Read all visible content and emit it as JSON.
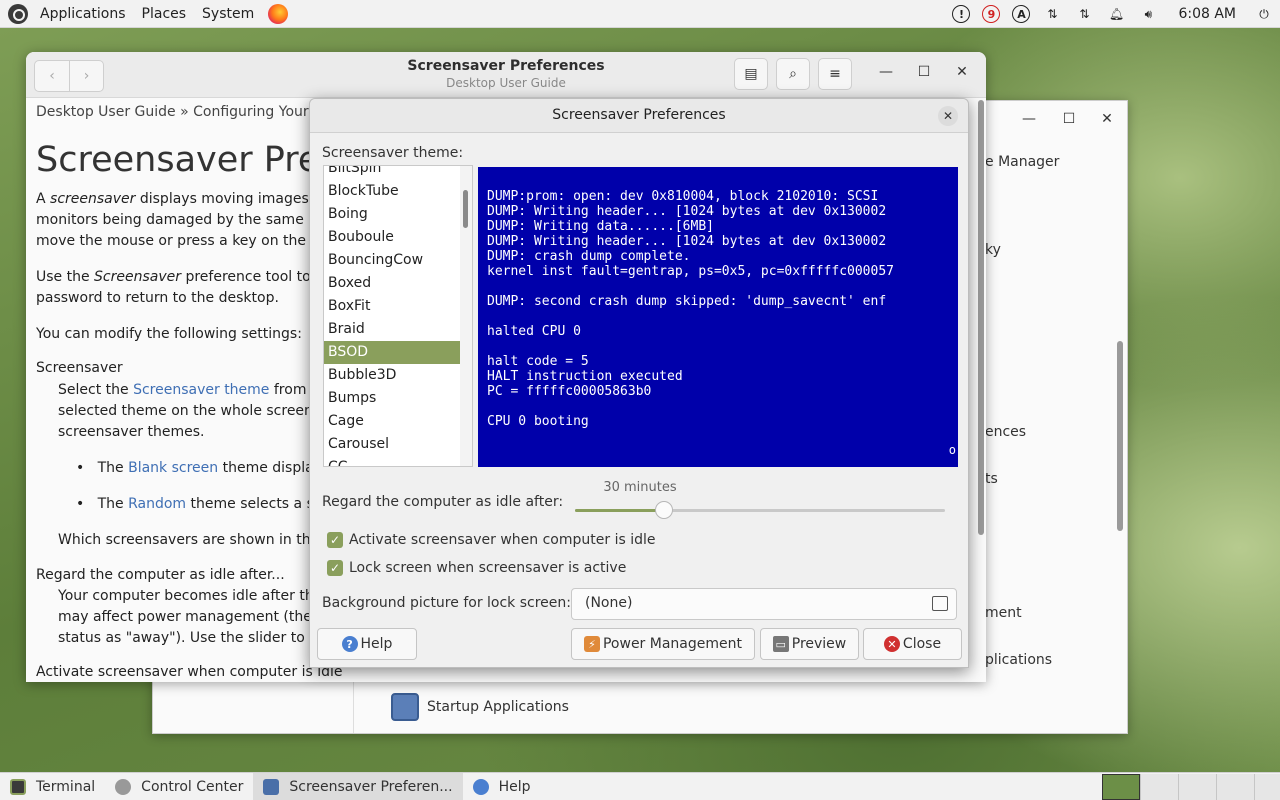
{
  "top_panel": {
    "menus": [
      "Applications",
      "Places",
      "System"
    ],
    "tray_badges": {
      "info": "!",
      "count": "9",
      "access": "A"
    },
    "clock": "6:08 AM"
  },
  "help_window": {
    "title": "Screensaver Preferences",
    "subtitle": "Desktop User Guide",
    "breadcrumb": "Desktop User Guide » Configuring Your D",
    "heading": "Screensaver Pref",
    "p1a_pre": "A ",
    "p1a_em": "screensaver",
    "p1a_post": " displays moving images or",
    "p1b": "monitors being damaged by the same im",
    "p1c": "move the mouse or press a key on the ke",
    "p2a_pre": "Use the ",
    "p2a_em": "Screensaver",
    "p2a_post": " preference tool to se",
    "p2b": "password to return to the desktop.",
    "p3": "You can modify the following settings:",
    "term1": "Screensaver",
    "t1a_pre": "Select the ",
    "t1a_link": "Screensaver theme",
    "t1a_post": " from th",
    "t1b": "selected theme on the whole screen.",
    "t1c": "screensaver themes.",
    "b1_pre": "The ",
    "b1_link": "Blank screen",
    "b1_post": " theme displays",
    "b2_pre": "The ",
    "b2_link": "Random",
    "b2_post": " theme selects a scr",
    "t1d": "Which screensavers are shown in the",
    "term2": "Regard the computer as idle after...",
    "t2a": "Your computer becomes idle after thi",
    "t2b": "may affect power management (the m",
    "t2c": "status as \"away\"). Use the slider to se",
    "term3": "Activate screensaver when computer is idle"
  },
  "control_center": {
    "items": [
      "e Manager",
      "ky",
      "ences",
      "ts",
      "ment",
      "plications"
    ],
    "startup": "Startup Applications"
  },
  "dialog": {
    "title": "Screensaver Preferences",
    "theme_label": "Screensaver theme:",
    "themes": [
      "BlitSpin",
      "BlockTube",
      "Boing",
      "Bouboule",
      "BouncingCow",
      "Boxed",
      "BoxFit",
      "Braid",
      "BSOD",
      "Bubble3D",
      "Bumps",
      "Cage",
      "Carousel",
      "CC"
    ],
    "selected_theme": "BSOD",
    "preview_lines": [
      "DUMP:prom: open: dev 0x810004, block 2102010: SCSI",
      "DUMP: Writing header... [1024 bytes at dev 0x130002",
      "DUMP: Writing data......[6MB]",
      "DUMP: Writing header... [1024 bytes at dev 0x130002",
      "DUMP: crash dump complete.",
      "kernel inst fault=gentrap, ps=0x5, pc=0xfffffc000057",
      "",
      "DUMP: second crash dump skipped: 'dump_savecnt' enf",
      "",
      "halted CPU 0",
      "",
      "halt code = 5",
      "HALT instruction executed",
      "PC = fffffc00005863b0",
      "",
      "CPU 0 booting"
    ],
    "preview_corner": "o",
    "idle_label": "Regard the computer as idle after:",
    "idle_value_text": "30 minutes",
    "idle_fraction": 0.24,
    "activate_label": "Activate screensaver when computer is idle",
    "lock_label": "Lock screen when screensaver is active",
    "bg_label": "Background picture for lock screen:",
    "bg_value": "(None)",
    "help_btn": "Help",
    "power_btn": "Power Management",
    "preview_btn": "Preview",
    "close_btn": "Close"
  },
  "taskbar": {
    "tasks": [
      "Terminal",
      "Control Center",
      "Screensaver Preferen...",
      "Help"
    ]
  },
  "colors": {
    "accent": "#8a9f5c",
    "bsod_blue": "#0000aa"
  }
}
